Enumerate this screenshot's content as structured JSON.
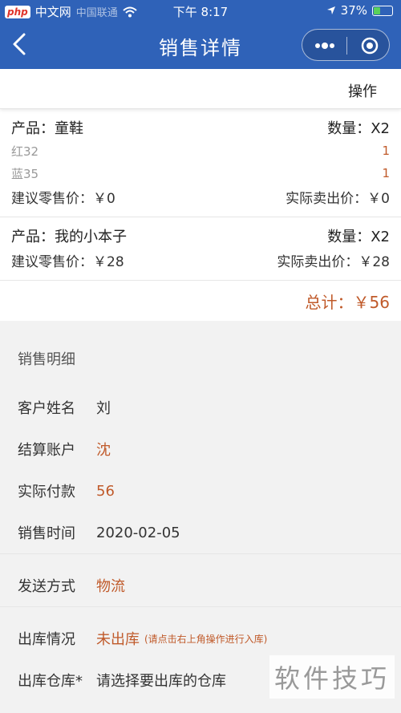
{
  "status_bar": {
    "carrier": "中国联通",
    "logo_text": "php",
    "logo_suffix": "中文网",
    "time": "下午 8:17",
    "battery": "37%",
    "battery_level": 0.37
  },
  "nav": {
    "title": "销售详情"
  },
  "actionbar": {
    "operation_label": "操作"
  },
  "products": [
    {
      "name_label": "产品：童鞋",
      "qty_label": "数量：X2",
      "variants": [
        {
          "name": "红32",
          "qty": "1"
        },
        {
          "name": "蓝35",
          "qty": "1"
        }
      ],
      "suggested_price": "建议零售价：￥0",
      "actual_price": "实际卖出价：￥0"
    },
    {
      "name_label": "产品：我的小本子",
      "qty_label": "数量：X2",
      "suggested_price": "建议零售价：￥28",
      "actual_price": "实际卖出价：￥28"
    }
  ],
  "total": "总计：￥56",
  "sales_detail": {
    "title": "销售明细",
    "customer_name_label": "客户姓名",
    "customer_name": "刘",
    "account_label": "结算账户",
    "account": "沈",
    "paid_label": "实际付款",
    "paid": "56",
    "time_label": "销售时间",
    "time": "2020-02-05",
    "shipping_label": "发送方式",
    "shipping": "物流",
    "stock_label": "出库情况",
    "stock_status": "未出库",
    "stock_hint": "(请点击右上角操作进行入库)",
    "warehouse_label": "出库仓库*",
    "warehouse_placeholder": "请选择要出库的仓库"
  },
  "watermark": "软件技巧",
  "colors": {
    "nav_bg": "#2f62b8",
    "accent_orange": "#c05a2a"
  }
}
